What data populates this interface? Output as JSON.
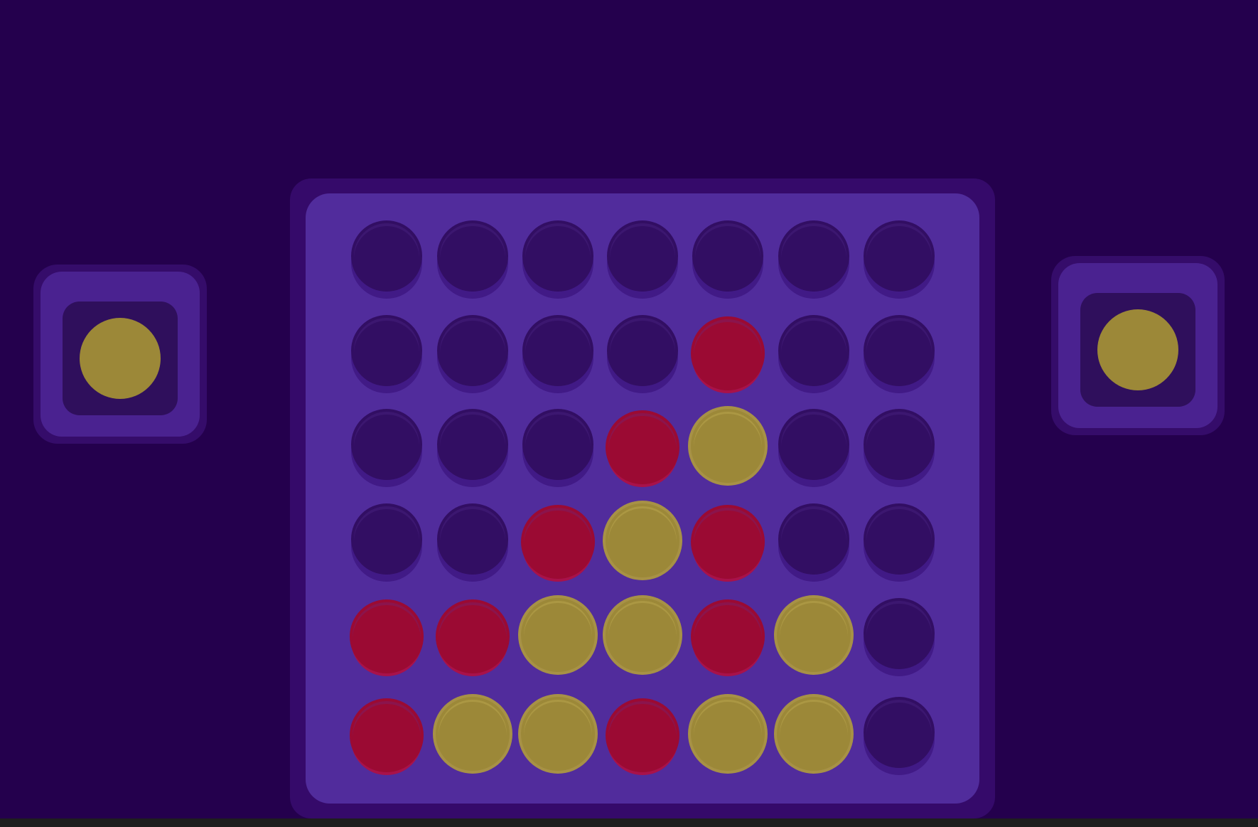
{
  "colors": {
    "background": "#24004d",
    "board": "#512c9c",
    "board_frame": "#350a6a",
    "empty": "#320e63",
    "red": "#9b0a33",
    "yellow": "#9c8838"
  },
  "players": {
    "left": {
      "disc_color": "yellow"
    },
    "right": {
      "disc_color": "yellow"
    }
  },
  "board": {
    "columns": 7,
    "rows": 6,
    "grid": [
      [
        "empty",
        "empty",
        "empty",
        "empty",
        "empty",
        "empty",
        "empty"
      ],
      [
        "empty",
        "empty",
        "empty",
        "empty",
        "red",
        "empty",
        "empty"
      ],
      [
        "empty",
        "empty",
        "empty",
        "red",
        "yellow",
        "empty",
        "empty"
      ],
      [
        "empty",
        "empty",
        "red",
        "yellow",
        "red",
        "empty",
        "empty"
      ],
      [
        "red",
        "red",
        "yellow",
        "yellow",
        "red",
        "yellow",
        "empty"
      ],
      [
        "red",
        "yellow",
        "yellow",
        "red",
        "yellow",
        "yellow",
        "empty"
      ]
    ]
  }
}
